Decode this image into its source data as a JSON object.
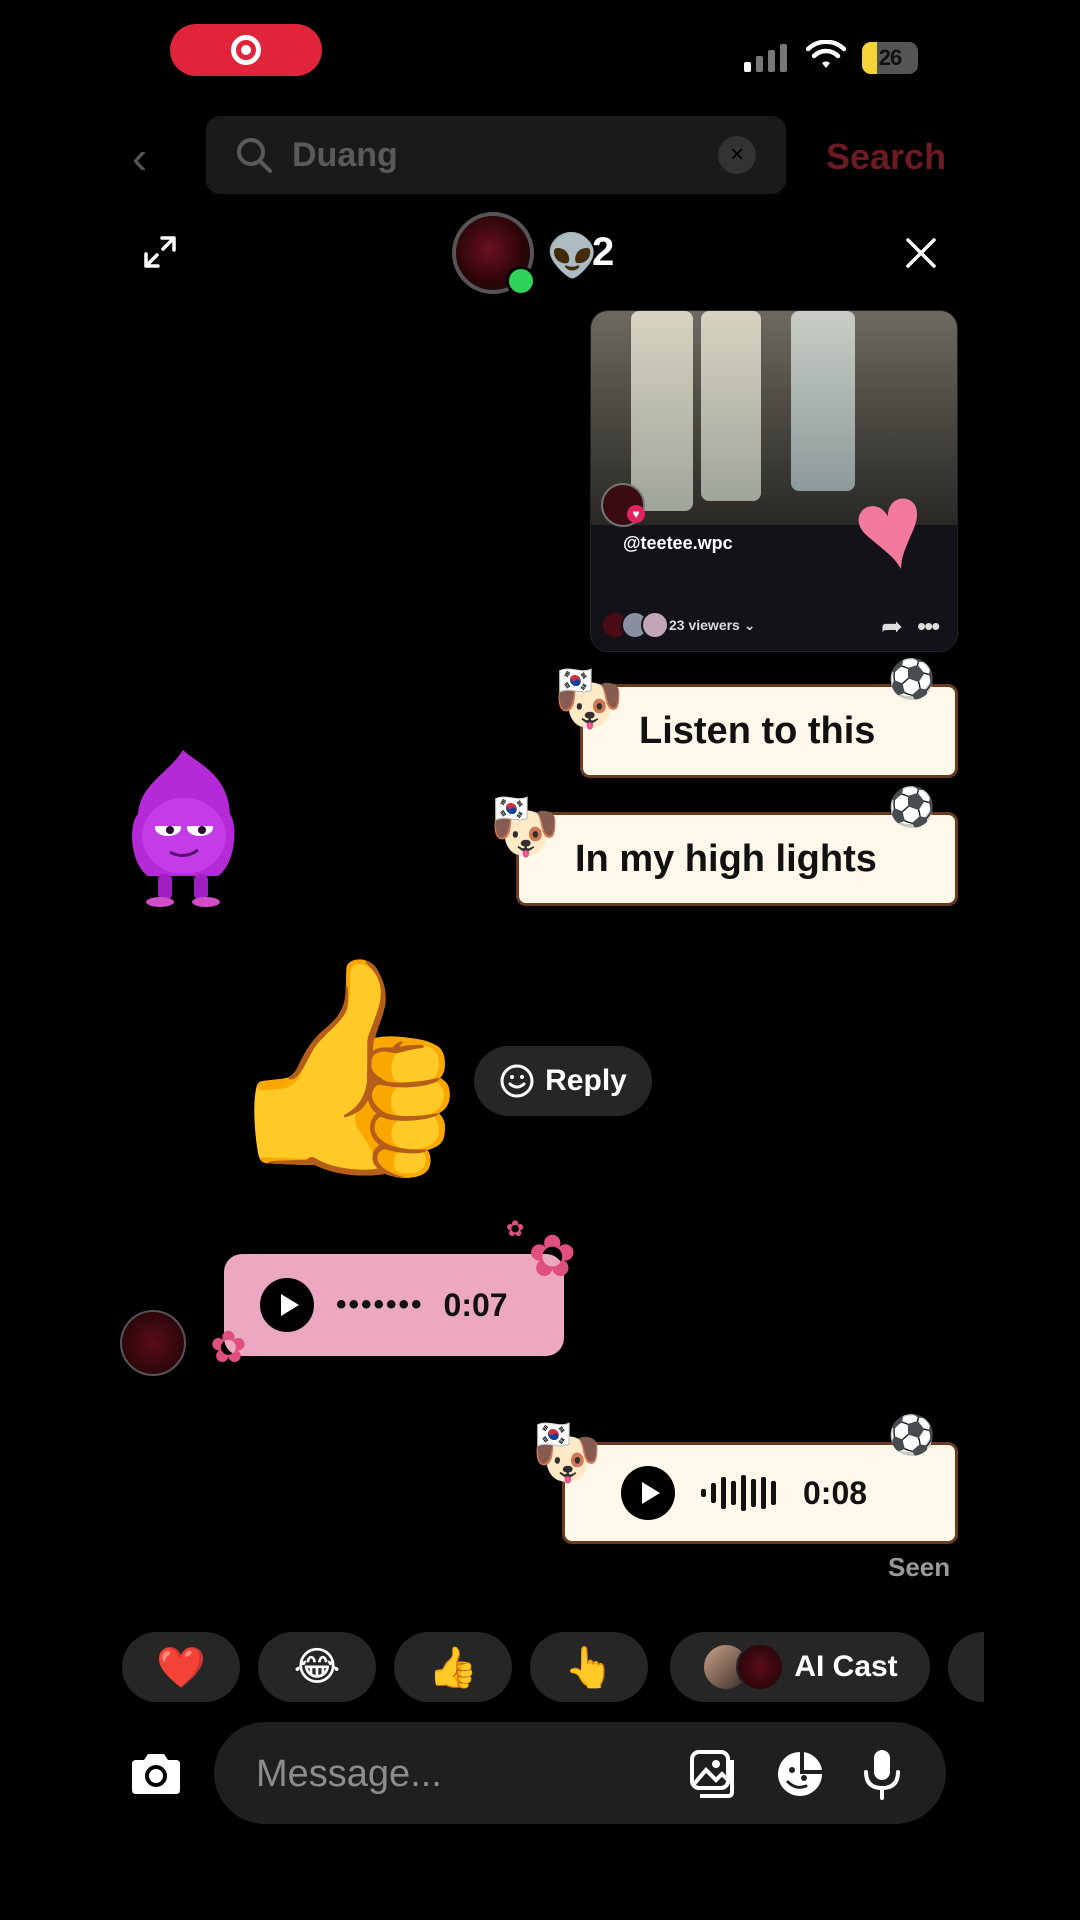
{
  "search": {
    "placeholder": "Duang",
    "button_label": "Search"
  },
  "status": {
    "battery": "26",
    "battery_level": 0.26
  },
  "chat": {
    "member_count": "2",
    "member_emoji": "👽",
    "video_card": {
      "handle": "@teetee.wpc",
      "viewers": "23 viewers ⌄"
    },
    "messages": {
      "listen": "Listen to this",
      "highlights": "In my high lights",
      "reply_label": "Reply",
      "voice_in_duration": "0:07",
      "voice_out_duration": "0:08",
      "seen": "Seen"
    }
  },
  "reactions": [
    "❤️",
    "😂",
    "👍",
    "👆"
  ],
  "ai_cast": {
    "label": "AI Cast"
  },
  "composer": {
    "placeholder": "Message..."
  },
  "colors": {
    "accent": "#e0243a",
    "sticker_bg": "#fdf8ea",
    "voice_in_bg": "#eba8c0",
    "online": "#2fd35a"
  },
  "icons": [
    "screen-record-icon",
    "signal-icon",
    "wifi-icon",
    "battery-icon",
    "back-arrow-icon",
    "search-icon",
    "clear-icon",
    "expand-icon",
    "close-icon",
    "share-icon",
    "more-icon",
    "play-icon",
    "smile-icon",
    "camera-icon",
    "gallery-icon",
    "sticker-icon",
    "mic-icon"
  ]
}
